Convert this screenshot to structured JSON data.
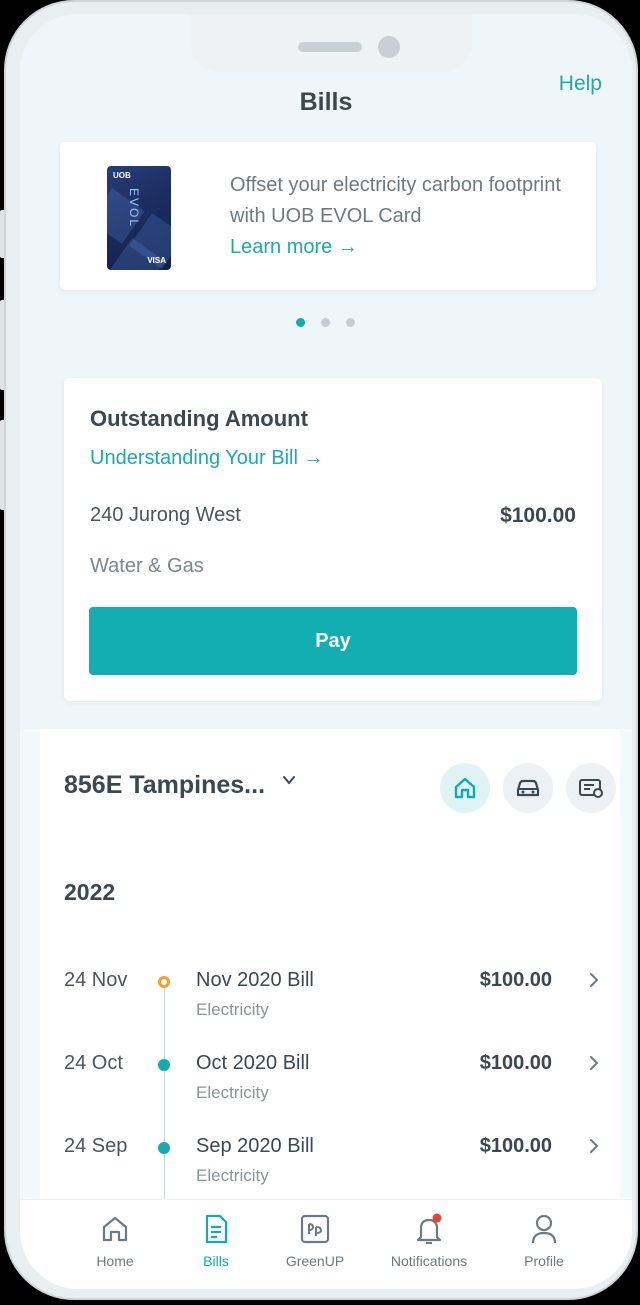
{
  "header": {
    "title": "Bills",
    "help_label": "Help"
  },
  "promo": {
    "card_bank": "UOB",
    "card_name": "EVOL",
    "card_network": "VISA",
    "text": "Offset your electricity carbon footprint with UOB EVOL Card",
    "link_label": "Learn more →",
    "slides_total": 3,
    "slide_active": 1
  },
  "outstanding": {
    "title": "Outstanding Amount",
    "link_label": "Understanding Your Bill →",
    "address": "240 Jurong West",
    "amount": "$100.00",
    "type": "Water & Gas",
    "pay_label": "Pay"
  },
  "property": {
    "selected": "856E Tampines...",
    "categories": [
      "home-icon",
      "car-icon",
      "certificate-icon"
    ],
    "active_category": "home-icon"
  },
  "history": {
    "year": "2022",
    "bills": [
      {
        "date": "24 Nov",
        "name": "Nov 2020 Bill",
        "type": "Electricity",
        "amount": "$100.00",
        "status": "pending"
      },
      {
        "date": "24 Oct",
        "name": "Oct 2020 Bill",
        "type": "Electricity",
        "amount": "$100.00",
        "status": "paid"
      },
      {
        "date": "24 Sep",
        "name": "Sep 2020 Bill",
        "type": "Electricity",
        "amount": "$100.00",
        "status": "paid"
      }
    ]
  },
  "tabs": [
    {
      "label": "Home",
      "icon": "home-icon"
    },
    {
      "label": "Bills",
      "icon": "bill-icon"
    },
    {
      "label": "GreenUP",
      "icon": "greenup-icon"
    },
    {
      "label": "Notifications",
      "icon": "bell-icon"
    },
    {
      "label": "Profile",
      "icon": "person-icon"
    }
  ],
  "active_tab": "Bills",
  "colors": {
    "accent": "#12aeb1",
    "pending": "#f0a12a",
    "text": "#3b4852",
    "background": "#eef6f9"
  }
}
